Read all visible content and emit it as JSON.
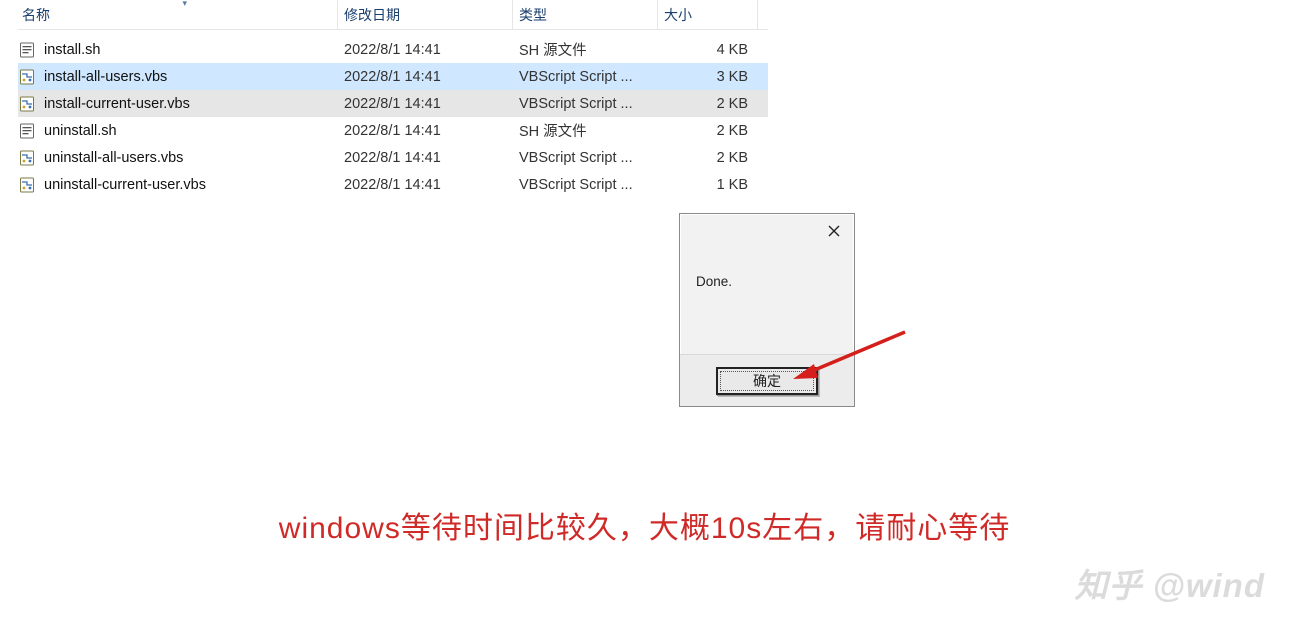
{
  "columns": {
    "name": "名称",
    "date": "修改日期",
    "type": "类型",
    "size": "大小"
  },
  "files": [
    {
      "icon": "sh",
      "name": "install.sh",
      "date": "2022/8/1 14:41",
      "type": "SH 源文件",
      "size": "4 KB",
      "state": ""
    },
    {
      "icon": "vbs",
      "name": "install-all-users.vbs",
      "date": "2022/8/1 14:41",
      "type": "VBScript Script ...",
      "size": "3 KB",
      "state": "selected"
    },
    {
      "icon": "vbs",
      "name": "install-current-user.vbs",
      "date": "2022/8/1 14:41",
      "type": "VBScript Script ...",
      "size": "2 KB",
      "state": "hover"
    },
    {
      "icon": "sh",
      "name": "uninstall.sh",
      "date": "2022/8/1 14:41",
      "type": "SH 源文件",
      "size": "2 KB",
      "state": ""
    },
    {
      "icon": "vbs",
      "name": "uninstall-all-users.vbs",
      "date": "2022/8/1 14:41",
      "type": "VBScript Script ...",
      "size": "2 KB",
      "state": ""
    },
    {
      "icon": "vbs",
      "name": "uninstall-current-user.vbs",
      "date": "2022/8/1 14:41",
      "type": "VBScript Script ...",
      "size": "1 KB",
      "state": ""
    }
  ],
  "dialog": {
    "message": "Done.",
    "ok_label": "确定"
  },
  "caption": "windows等待时间比较久，大概10s左右，请耐心等待",
  "watermark": "知乎 @wind",
  "colors": {
    "accent_blue": "#cfe7ff",
    "hover_gray": "#e6e6e6",
    "annotation_red": "#cf2a27"
  }
}
